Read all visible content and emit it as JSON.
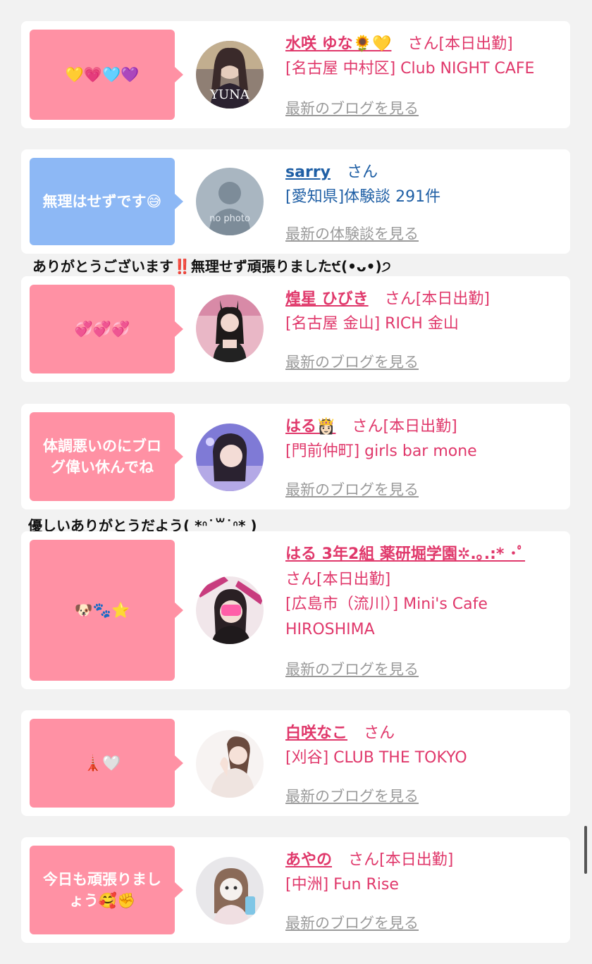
{
  "colors": {
    "pink": "#ff91a4",
    "blue": "#8db8f5",
    "name_pink": "#e0386b",
    "name_blue": "#1f5fa5",
    "link_gray": "#9a9a9a"
  },
  "entries": [
    {
      "bubble": "💛💗🩵💜",
      "name": "水咲 ゆな🌻💛",
      "suffix": "さん[本日出勤]",
      "lines": [
        "[名古屋 中村区] Club NIGHT CAFE"
      ],
      "link": "最新のブログを見る",
      "avatar_label": "YUNA"
    },
    {
      "bubble": "無理はせずです😅",
      "name": "sarry",
      "suffix": "さん",
      "lines": [
        "[愛知県]体験談 291件"
      ],
      "link": "最新の体験談を見る",
      "avatar_label": "no photo"
    },
    {
      "bubble": "💞💞💞",
      "name": "煌星 ひびき",
      "suffix": "さん[本日出勤]",
      "lines": [
        "[名古屋 金山] RICH 金山"
      ],
      "link": "最新のブログを見る"
    },
    {
      "bubble": "体調悪いのにブログ偉い休んでね",
      "name": "はる👸🏻",
      "suffix": "さん[本日出勤]",
      "lines": [
        "[門前仲町] girls bar mone"
      ],
      "link": "最新のブログを見る"
    },
    {
      "bubble": "🐶🐾⭐️",
      "name": "はる 3年2組 薬研堀学園✲.｡.:* ･ﾟ",
      "suffix": "さん[本日出勤]",
      "lines": [
        "[広島市（流川）] Mini's Cafe",
        "HIROSHIMA"
      ],
      "link": "最新のブログを見る"
    },
    {
      "bubble": "🗼🤍",
      "name": "白咲なこ",
      "suffix": "さん",
      "lines": [
        "[刈谷] CLUB THE TOKYO"
      ],
      "link": "最新のブログを見る"
    },
    {
      "bubble": "今日も頑張りましょう🥰✊",
      "name": "あやの",
      "suffix": "さん[本日出勤]",
      "lines": [
        "[中洲] Fun Rise"
      ],
      "link": "最新のブログを見る"
    }
  ],
  "comments": [
    "ありがとうございます‼️無理せず頑張りました੯(•ᴗ•)੭",
    "優しいありがとうだよう( *ᐢ˙꒳˙ᐢ* )"
  ]
}
